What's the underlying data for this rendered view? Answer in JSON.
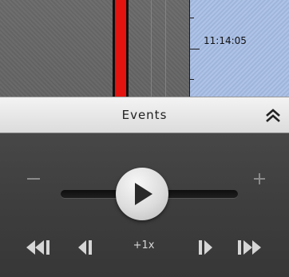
{
  "timeline": {
    "time_label": "11:14:05"
  },
  "events": {
    "title": "Events"
  },
  "player": {
    "speed_label": "+1x"
  },
  "colors": {
    "marker_red": "#e4130f",
    "range_blue": "#a9bfe6",
    "panel_dark": "#3d3d3d"
  },
  "icons": {
    "collapse": "double-chevron-up-icon",
    "play": "play-icon",
    "to_start": "skip-to-start-icon",
    "step_back": "step-back-icon",
    "step_forward": "step-forward-icon",
    "to_end": "skip-to-end-icon"
  }
}
